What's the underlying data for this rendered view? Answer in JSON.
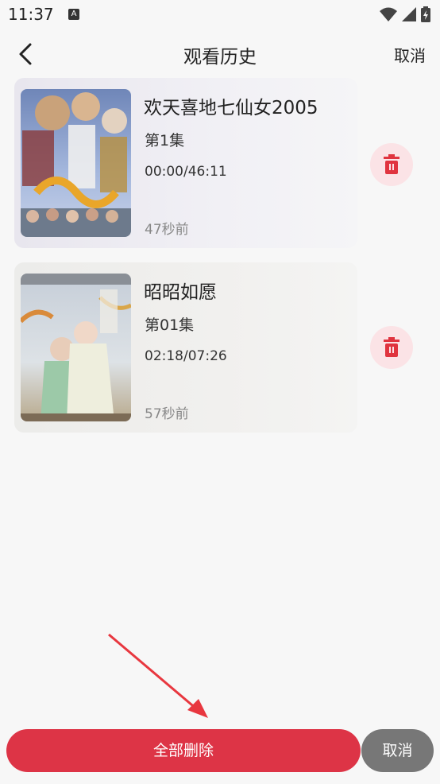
{
  "status_bar": {
    "time": "11:37",
    "notification_glyph": "A",
    "icons": [
      "wifi-icon",
      "signal-icon",
      "battery-charging-icon"
    ]
  },
  "header": {
    "title": "观看历史",
    "cancel_label": "取消",
    "back_icon": "chevron-left-icon"
  },
  "history": [
    {
      "title": "欢天喜地七仙女2005",
      "episode": "第1集",
      "progress": "00:00/46:11",
      "time_ago": "47秒前",
      "delete_icon": "trash-icon"
    },
    {
      "title": "昭昭如愿",
      "episode": "第01集",
      "progress": "02:18/07:26",
      "time_ago": "57秒前",
      "delete_icon": "trash-icon"
    }
  ],
  "footer": {
    "delete_all_label": "全部删除",
    "cancel_label": "取消"
  },
  "colors": {
    "accent": "#dd3446",
    "delete_bg": "#fbe3e6",
    "cancel_gray": "#777777",
    "arrow": "#e8373f"
  }
}
